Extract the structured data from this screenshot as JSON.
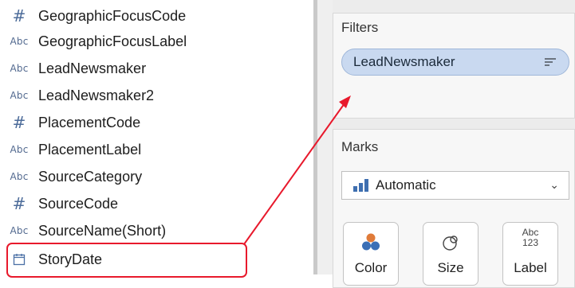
{
  "fields": [
    {
      "type": "hash",
      "icon": "#",
      "label": "GeographicFocusCode"
    },
    {
      "type": "abc",
      "icon": "Abc",
      "label": "GeographicFocusLabel"
    },
    {
      "type": "abc",
      "icon": "Abc",
      "label": "LeadNewsmaker"
    },
    {
      "type": "abc",
      "icon": "Abc",
      "label": "LeadNewsmaker2"
    },
    {
      "type": "hash",
      "icon": "#",
      "label": "PlacementCode"
    },
    {
      "type": "abc",
      "icon": "Abc",
      "label": "PlacementLabel"
    },
    {
      "type": "abc",
      "icon": "Abc",
      "label": "SourceCategory"
    },
    {
      "type": "hash",
      "icon": "#",
      "label": "SourceCode"
    },
    {
      "type": "abc",
      "icon": "Abc",
      "label": "SourceName(Short)"
    },
    {
      "type": "date",
      "icon": "calendar-icon",
      "label": "StoryDate"
    }
  ],
  "filters": {
    "title": "Filters",
    "pill_label": "LeadNewsmaker"
  },
  "marks": {
    "title": "Marks",
    "mark_type": "Automatic",
    "buttons": [
      {
        "label": "Color",
        "icon": "color-dots-icon"
      },
      {
        "label": "Size",
        "icon": "size-circles-icon"
      },
      {
        "label": "Label",
        "icon_text_top": "Abc",
        "icon_text_bottom": "123"
      }
    ]
  },
  "annotation": {
    "color": "#e8192c"
  }
}
